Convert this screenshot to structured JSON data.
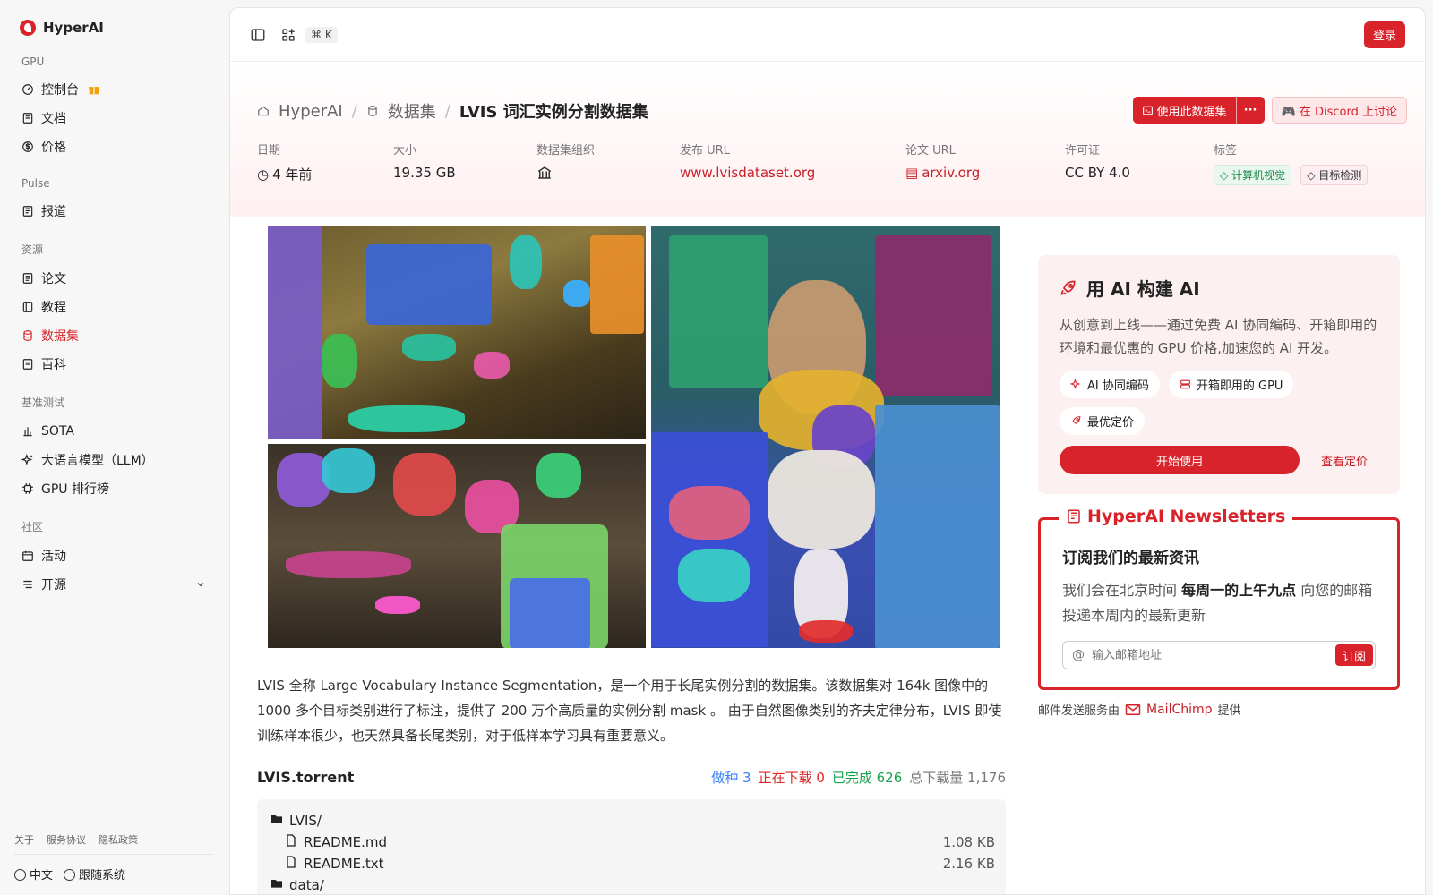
{
  "sidebar": {
    "brand": "HyperAI",
    "sections": [
      {
        "title": "GPU",
        "items": [
          {
            "label": "控制台",
            "icon": "gauge-icon"
          },
          {
            "label": "文档",
            "icon": "doc-icon"
          },
          {
            "label": "价格",
            "icon": "dollar-icon"
          }
        ]
      },
      {
        "title": "Pulse",
        "items": [
          {
            "label": "报道",
            "icon": "news-icon"
          }
        ]
      },
      {
        "title": "资源",
        "items": [
          {
            "label": "论文",
            "icon": "paper-icon"
          },
          {
            "label": "教程",
            "icon": "book-icon"
          },
          {
            "label": "数据集",
            "icon": "database-icon"
          },
          {
            "label": "百科",
            "icon": "wiki-icon"
          }
        ]
      },
      {
        "title": "基准测试",
        "items": [
          {
            "label": "SOTA",
            "icon": "bar-chart-icon"
          },
          {
            "label": "大语言模型（LLM）",
            "icon": "sparkles-icon"
          },
          {
            "label": "GPU 排行榜",
            "icon": "chip-icon"
          }
        ]
      },
      {
        "title": "社区",
        "items": [
          {
            "label": "活动",
            "icon": "calendar-icon"
          },
          {
            "label": "开源",
            "icon": "list-icon"
          }
        ]
      }
    ],
    "footer_links": [
      "关于",
      "服务协议",
      "隐私政策"
    ],
    "language": "中文",
    "theme": "跟随系统"
  },
  "topbar": {
    "shortcut": "⌘ K",
    "login": "登录"
  },
  "header": {
    "breadcrumb": [
      "HyperAI",
      "数据集",
      "LVIS 词汇实例分割数据集"
    ],
    "use_dataset": "使用此数据集",
    "discord": "在 Discord 上讨论",
    "meta": {
      "date_label": "日期",
      "date_value": "4 年前",
      "size_label": "大小",
      "size_value": "19.35 GB",
      "org_label": "数据集组织",
      "url_label": "发布 URL",
      "url_value": "www.lvisdataset.org",
      "paper_label": "论文 URL",
      "paper_value": "arxiv.org",
      "license_label": "许可证",
      "license_value": "CC BY 4.0",
      "tags_label": "标签",
      "tags": [
        "计算机视觉",
        "目标检测"
      ]
    }
  },
  "content": {
    "description": "LVIS 全称 Large Vocabulary Instance Segmentation，是一个用于长尾实例分割的数据集。该数据集对 164k 图像中的 1000 多个目标类别进行了标注，提供了 200 万个高质量的实例分割 mask 。 由于自然图像类别的齐夫定律分布，LVIS 即使训练样本很少，也天然具备长尾类别，对于低样本学习具有重要意义。",
    "torrent_name": "LVIS.torrent",
    "stats": {
      "seeding": "做种 3",
      "downloading": "正在下载 0",
      "completed": "已完成 626",
      "total": "总下载量 1,176"
    },
    "files": [
      {
        "name": "LVIS/",
        "size": "",
        "folder": true,
        "indent": false
      },
      {
        "name": "README.md",
        "size": "1.08 KB",
        "folder": false,
        "indent": true
      },
      {
        "name": "README.txt",
        "size": "2.16 KB",
        "folder": false,
        "indent": true
      },
      {
        "name": "data/",
        "size": "",
        "folder": true,
        "indent": false
      }
    ]
  },
  "ai_card": {
    "title": "用 AI 构建 AI",
    "description": "从创意到上线——通过免费 AI 协同编码、开箱即用的环境和最优惠的 GPU 价格,加速您的 AI 开发。",
    "chips": [
      "AI 协同编码",
      "开箱即用的 GPU",
      "最优定价"
    ],
    "start": "开始使用",
    "pricing": "查看定价"
  },
  "newsletter": {
    "title": "HyperAI Newsletters",
    "heading": "订阅我们的最新资讯",
    "text_before": "我们会在北京时间 ",
    "text_bold": "每周一的上午九点",
    "text_after": " 向您的邮箱投递本周内的最新更新",
    "placeholder": "输入邮箱地址",
    "subscribe": "订阅",
    "provider_before": "邮件发送服务由",
    "provider_name": "MailChimp",
    "provider_after": "提供"
  }
}
